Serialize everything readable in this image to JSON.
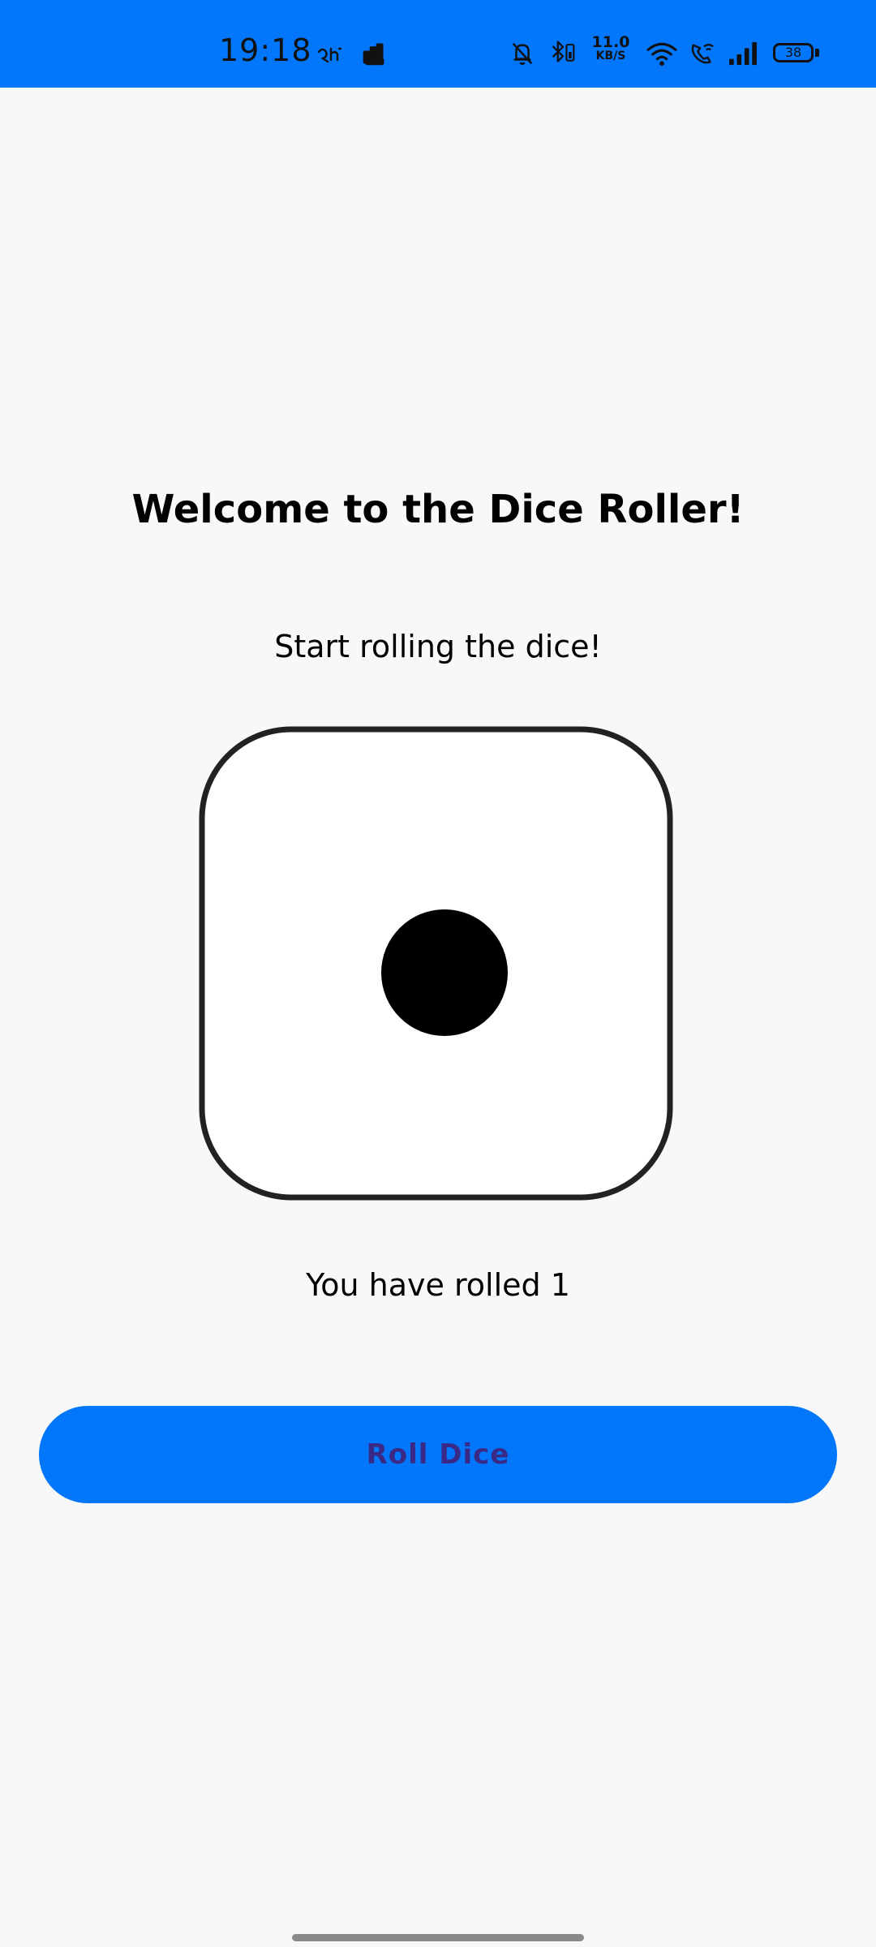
{
  "status_bar": {
    "time": "19:18",
    "network_speed_value": "11.0",
    "network_speed_unit": "KB/S",
    "battery_level": "38",
    "icons": [
      "hindi-indicator-icon",
      "app-notification-icon",
      "mute-bell-icon",
      "bluetooth-icon",
      "wifi-icon",
      "wifi-calling-icon",
      "signal-icon",
      "battery-icon"
    ],
    "background_color": "#0277fb"
  },
  "main": {
    "title": "Welcome to the Dice Roller!",
    "subtitle": "Start rolling the dice!",
    "die_value": 1,
    "result_text": "You have rolled 1",
    "roll_button_label": "Roll Dice"
  },
  "colors": {
    "accent": "#0277fb",
    "button_text": "#3a2a86",
    "background": "#f8f8f8"
  }
}
